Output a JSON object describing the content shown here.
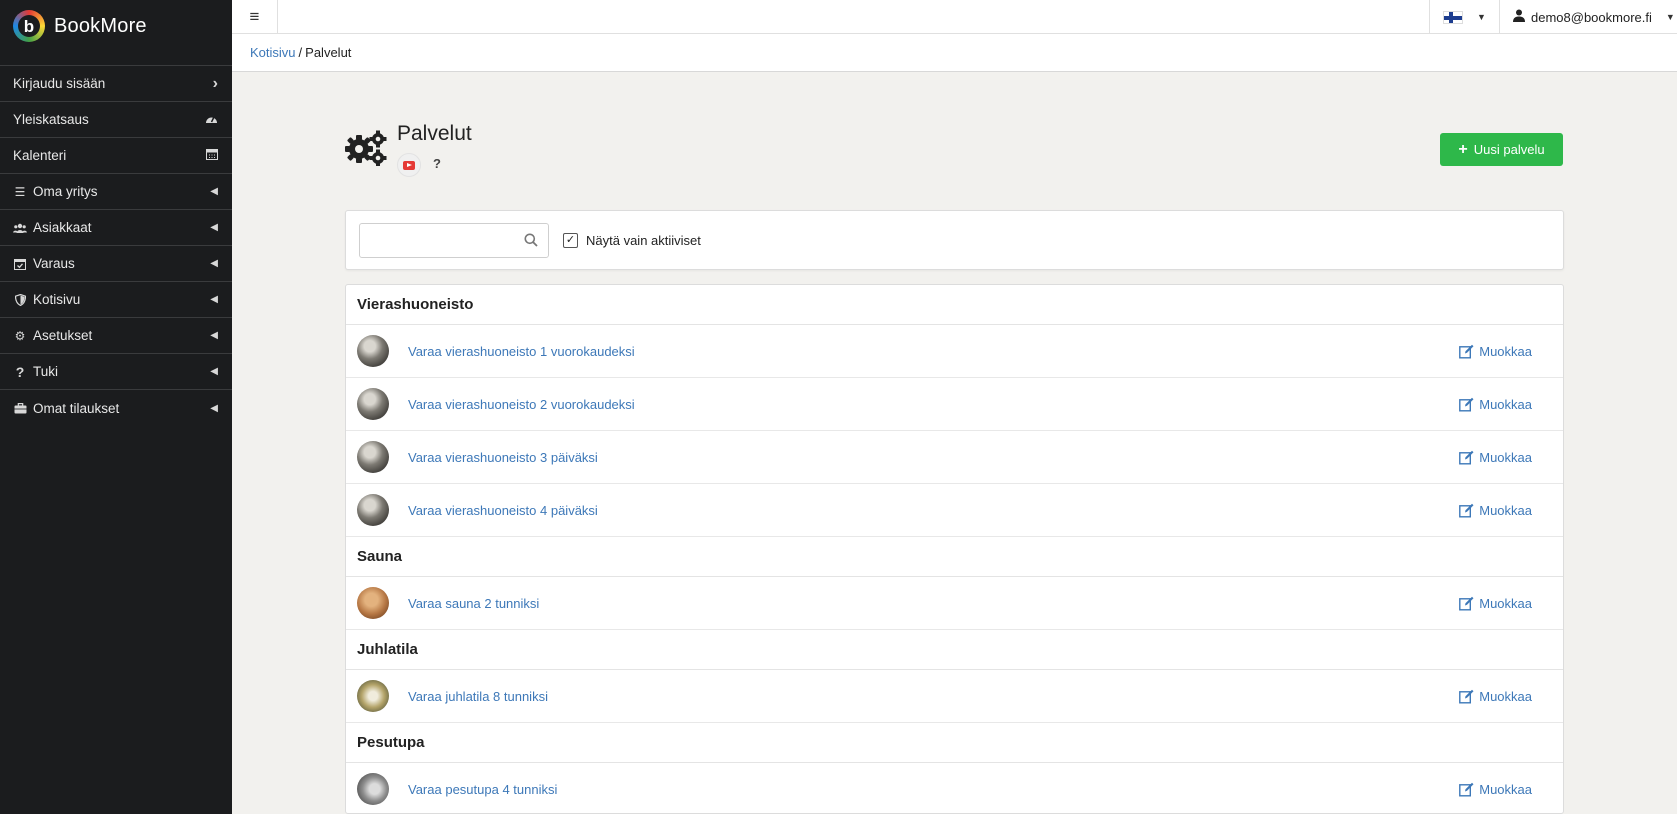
{
  "app": {
    "name": "BookMore",
    "logo_letter": "b"
  },
  "sidebar": {
    "items": [
      {
        "label": "Kirjaudu sisään",
        "icon": "chevron-right-icon",
        "right_icon": "chevron-right-icon"
      },
      {
        "label": "Yleiskatsaus",
        "right_icon": "dashboard-icon"
      },
      {
        "label": "Kalenteri",
        "right_icon": "calendar-icon"
      },
      {
        "label": "Oma yritys",
        "icon": "list-icon",
        "right_icon": "caret-left-icon"
      },
      {
        "label": "Asiakkaat",
        "icon": "users-icon",
        "right_icon": "caret-left-icon"
      },
      {
        "label": "Varaus",
        "icon": "calendar-check-icon",
        "right_icon": "caret-left-icon"
      },
      {
        "label": "Kotisivu",
        "icon": "shield-icon",
        "right_icon": "caret-left-icon"
      },
      {
        "label": "Asetukset",
        "icon": "cogs-icon",
        "right_icon": "caret-left-icon"
      },
      {
        "label": "Tuki",
        "icon": "question-icon",
        "right_icon": "caret-left-icon"
      },
      {
        "label": "Omat tilaukset",
        "icon": "briefcase-icon",
        "right_icon": "caret-left-icon"
      }
    ]
  },
  "topbar": {
    "menu_icon": "≡",
    "language": "fi",
    "user_email": "demo8@bookmore.fi"
  },
  "breadcrumb": {
    "home": "Kotisivu",
    "separator": "/",
    "current": "Palvelut"
  },
  "page": {
    "title": "Palvelut",
    "help_label": "?",
    "new_button_label": "Uusi palvelu",
    "new_button_color": "#2eb84a"
  },
  "filter": {
    "search_value": "",
    "search_placeholder": "",
    "only_active_label": "Näytä vain aktiiviset",
    "only_active_checked": true
  },
  "edit_label": "Muokkaa",
  "groups": [
    {
      "title": "Vierashuoneisto",
      "items": [
        {
          "name": "Varaa vierashuoneisto 1 vuorokaudeksi",
          "thumb": "room"
        },
        {
          "name": "Varaa vierashuoneisto 2 vuorokaudeksi",
          "thumb": "room"
        },
        {
          "name": "Varaa vierashuoneisto 3 päiväksi",
          "thumb": "room"
        },
        {
          "name": "Varaa vierashuoneisto 4 päiväksi",
          "thumb": "room"
        }
      ]
    },
    {
      "title": "Sauna",
      "items": [
        {
          "name": "Varaa sauna 2 tunniksi",
          "thumb": "sauna"
        }
      ]
    },
    {
      "title": "Juhlatila",
      "items": [
        {
          "name": "Varaa juhlatila 8 tunniksi",
          "thumb": "party"
        }
      ]
    },
    {
      "title": "Pesutupa",
      "items": [
        {
          "name": "Varaa pesutupa 4 tunniksi",
          "thumb": "laundry"
        }
      ]
    }
  ]
}
